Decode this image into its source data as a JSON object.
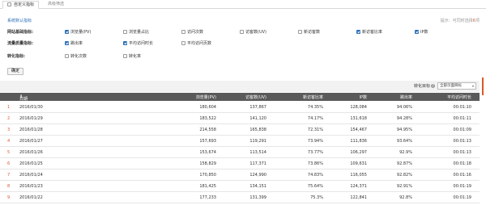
{
  "tabs": [
    {
      "label": "自定义指标"
    },
    {
      "label": "高级筛选"
    }
  ],
  "section_title": "系统默认指标",
  "hint": {
    "prefix": "提示：可同时选择",
    "count": "6",
    "suffix": "项"
  },
  "filter_rows": [
    {
      "label": "网站基础指标:",
      "options": [
        {
          "label": "浏览量(PV)",
          "checked": true
        },
        {
          "label": "浏览量占比",
          "checked": false
        },
        {
          "label": "访问次数",
          "checked": false
        },
        {
          "label": "访客数(UV)",
          "checked": false
        },
        {
          "label": "新访客数",
          "checked": false
        },
        {
          "label": "新访客比率",
          "checked": true
        },
        {
          "label": "IP数",
          "checked": true
        }
      ]
    },
    {
      "label": "流量质量指标:",
      "options": [
        {
          "label": "跳出率",
          "checked": true
        },
        {
          "label": "平均访问时长",
          "checked": true
        },
        {
          "label": "平均访问页数",
          "checked": false
        }
      ]
    },
    {
      "label": "转化指标:",
      "options": [
        {
          "label": "转化次数",
          "checked": false
        },
        {
          "label": "转化率",
          "checked": false
        }
      ]
    }
  ],
  "confirm_label": "确定",
  "toolbar": {
    "target_label": "转化目标",
    "target_help": "?",
    "select_value": "全部页面目标"
  },
  "table": {
    "headers": [
      "日期",
      "浏览量(PV)",
      "访客数(UV)",
      "新访客比率",
      "IP数",
      "跳出率",
      "平均访问时长"
    ],
    "rows": [
      [
        "1",
        "2016/01/30",
        "180,604",
        "137,867",
        "74.35%",
        "128,084",
        "94.06%",
        "00:01:10"
      ],
      [
        "2",
        "2016/01/29",
        "183,522",
        "141,120",
        "74.17%",
        "131,618",
        "94.28%",
        "00:01:11"
      ],
      [
        "3",
        "2016/01/28",
        "214,558",
        "165,838",
        "72.31%",
        "154,467",
        "94.95%",
        "00:01:09"
      ],
      [
        "4",
        "2016/01/27",
        "157,693",
        "119,291",
        "73.94%",
        "111,836",
        "93.64%",
        "00:01:13"
      ],
      [
        "5",
        "2016/01/26",
        "153,674",
        "113,514",
        "73.77%",
        "106,297",
        "92.9%",
        "00:01:13"
      ],
      [
        "6",
        "2016/01/25",
        "158,829",
        "117,371",
        "73.86%",
        "109,631",
        "92.87%",
        "00:01:18"
      ],
      [
        "7",
        "2016/01/24",
        "170,850",
        "124,990",
        "74.83%",
        "116,055",
        "92.82%",
        "00:01:16"
      ],
      [
        "8",
        "2016/01/23",
        "181,425",
        "134,151",
        "75.64%",
        "124,371",
        "92.91%",
        "00:01:19"
      ],
      [
        "9",
        "2016/01/22",
        "177,233",
        "131,399",
        "75.3%",
        "122,841",
        "92.8%",
        "00:01:19"
      ]
    ]
  },
  "colors": {
    "accent": "#2b6fb8",
    "highlight": "#e0572a",
    "header_bg": "#5a5a5a"
  }
}
